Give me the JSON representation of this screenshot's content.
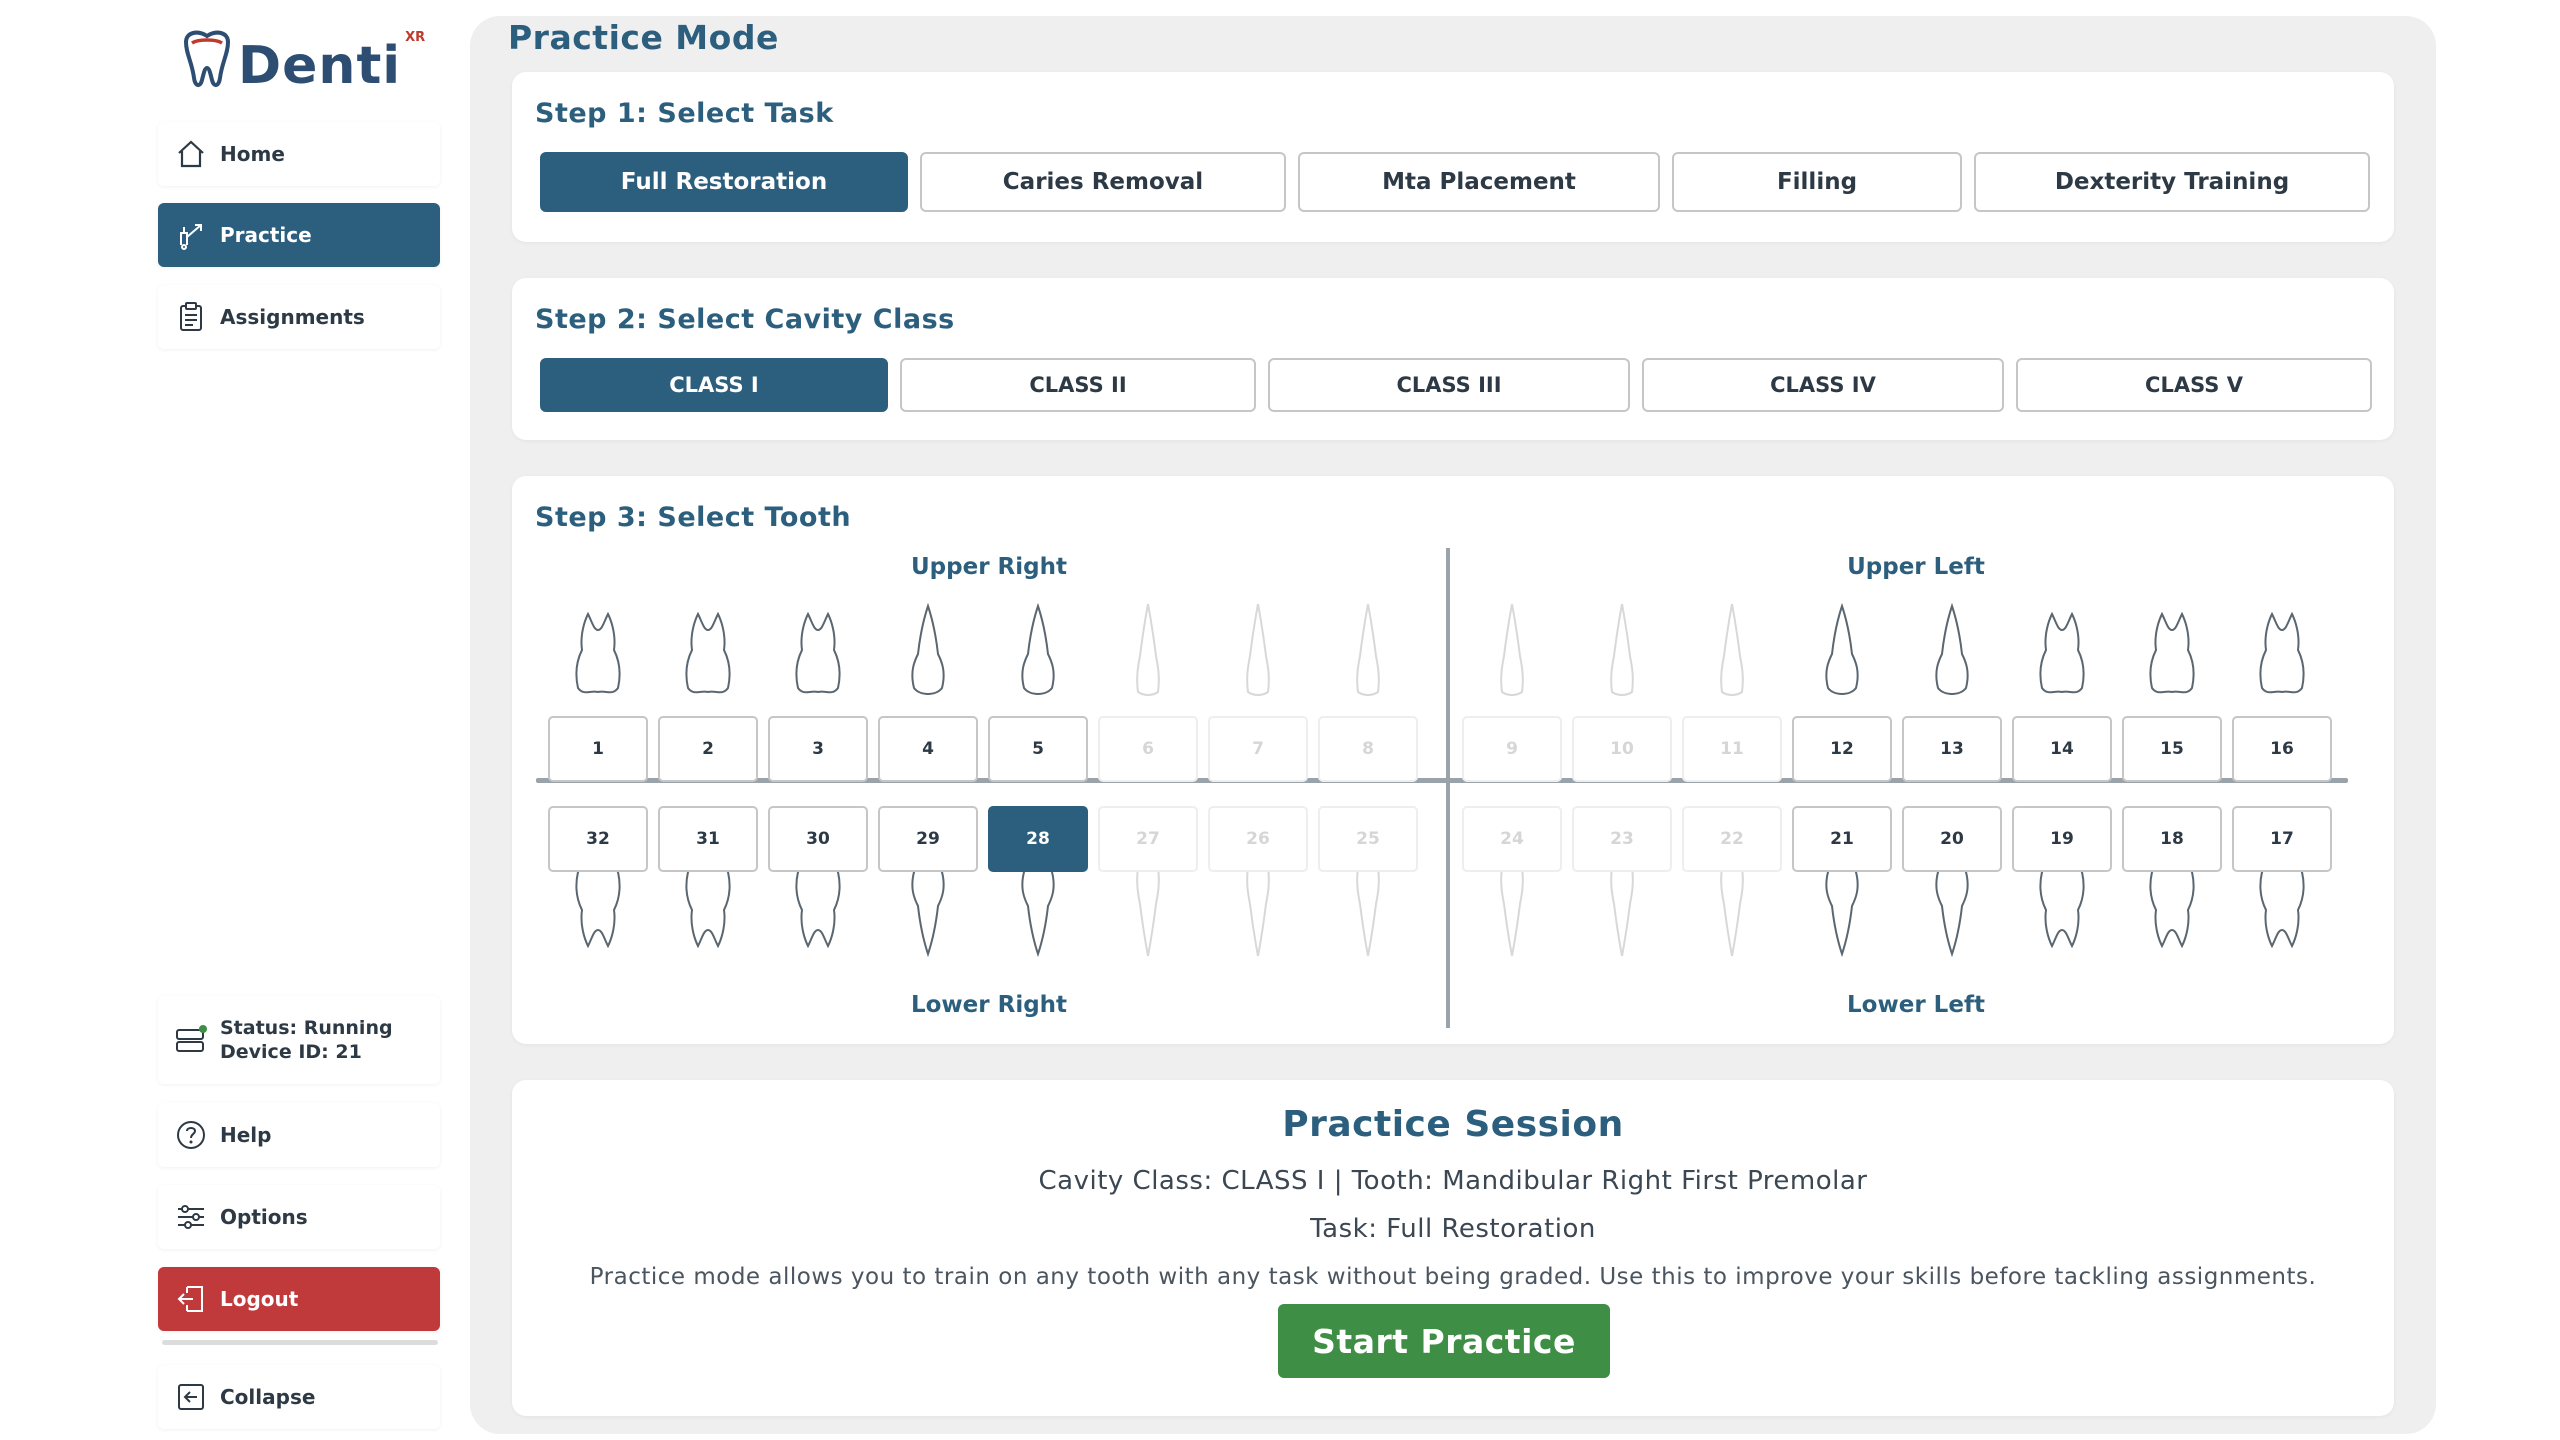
{
  "app": {
    "logo_text": "Denti",
    "logo_sup": "XR"
  },
  "sidebar": {
    "items": [
      {
        "id": "home",
        "label": "Home",
        "icon": "home-icon"
      },
      {
        "id": "practice",
        "label": "Practice",
        "icon": "dental-tool-icon",
        "active": true
      },
      {
        "id": "assignments",
        "label": "Assignments",
        "icon": "clipboard-icon"
      }
    ],
    "status": {
      "line1": "Status: Running",
      "line2": "Device ID: 21",
      "icon": "device-status-icon"
    },
    "help_label": "Help",
    "options_label": "Options",
    "logout_label": "Logout",
    "collapse_label": "Collapse"
  },
  "main": {
    "title": "Practice Mode",
    "step1": {
      "title": "Step 1: Select Task",
      "tasks": [
        "Full Restoration",
        "Caries Removal",
        "Mta Placement",
        "Filling",
        "Dexterity Training"
      ],
      "selected": "Full Restoration"
    },
    "step2": {
      "title": "Step 2: Select Cavity Class",
      "classes": [
        "CLASS I",
        "CLASS II",
        "CLASS III",
        "CLASS IV",
        "CLASS V"
      ],
      "selected": "CLASS I"
    },
    "step3": {
      "title": "Step 3: Select Tooth",
      "upper_right_label": "Upper Right",
      "upper_left_label": "Upper Left",
      "lower_right_label": "Lower Right",
      "lower_left_label": "Lower Left",
      "upper_teeth": [
        "1",
        "2",
        "3",
        "4",
        "5",
        "6",
        "7",
        "8",
        "9",
        "10",
        "11",
        "12",
        "13",
        "14",
        "15",
        "16"
      ],
      "lower_teeth": [
        "32",
        "31",
        "30",
        "29",
        "28",
        "27",
        "26",
        "25",
        "24",
        "23",
        "22",
        "21",
        "20",
        "19",
        "18",
        "17"
      ],
      "disabled": [
        "6",
        "7",
        "8",
        "9",
        "10",
        "11",
        "27",
        "26",
        "25",
        "24",
        "23",
        "22"
      ],
      "selected": "28"
    },
    "session": {
      "title": "Practice Session",
      "detail": "Cavity Class: CLASS I | Tooth: Mandibular Right First Premolar",
      "task": "Task: Full Restoration",
      "description": "Practice mode allows you to train on any tooth with any task without being graded. Use this to improve your skills before tackling assignments.",
      "start_label": "Start Practice"
    }
  },
  "colors": {
    "primary": "#2c5f7e",
    "logout": "#c0393b",
    "start": "#3f8e45",
    "panel": "#efefef"
  }
}
